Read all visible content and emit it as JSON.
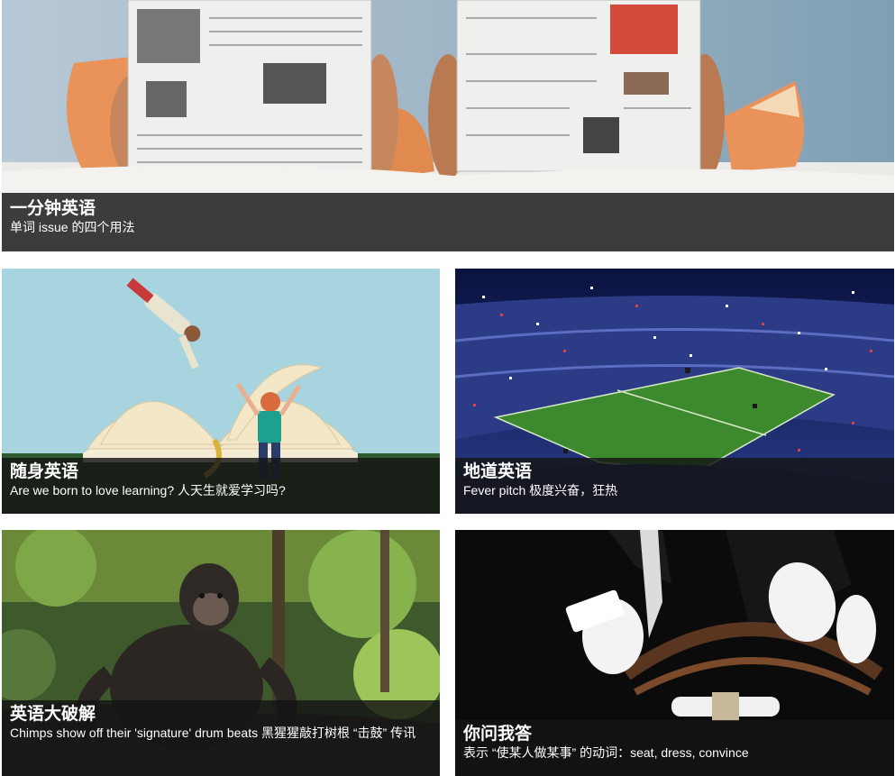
{
  "cards": [
    {
      "title": "一分钟英语",
      "subtitle": "单词 issue 的四个用法",
      "image": "newspaper-readers-in-bed"
    },
    {
      "title": "随身英语",
      "subtitle": "Are we born to love learning? 人天生就爱学习吗?",
      "image": "child-with-book-illustration"
    },
    {
      "title": "地道英语",
      "subtitle": "Fever pitch 极度兴奋，狂热",
      "image": "stadium-confetti"
    },
    {
      "title": "英语大破解",
      "subtitle": "Chimps show off their 'signature' drum beats 黑猩猩敲打树根 “击鼓” 传讯",
      "image": "chimpanzee-in-forest"
    },
    {
      "title": "你问我答",
      "subtitle": "表示 “使某人做某事” 的动词：seat, dress, convince",
      "image": "butler-holding-chair"
    }
  ]
}
